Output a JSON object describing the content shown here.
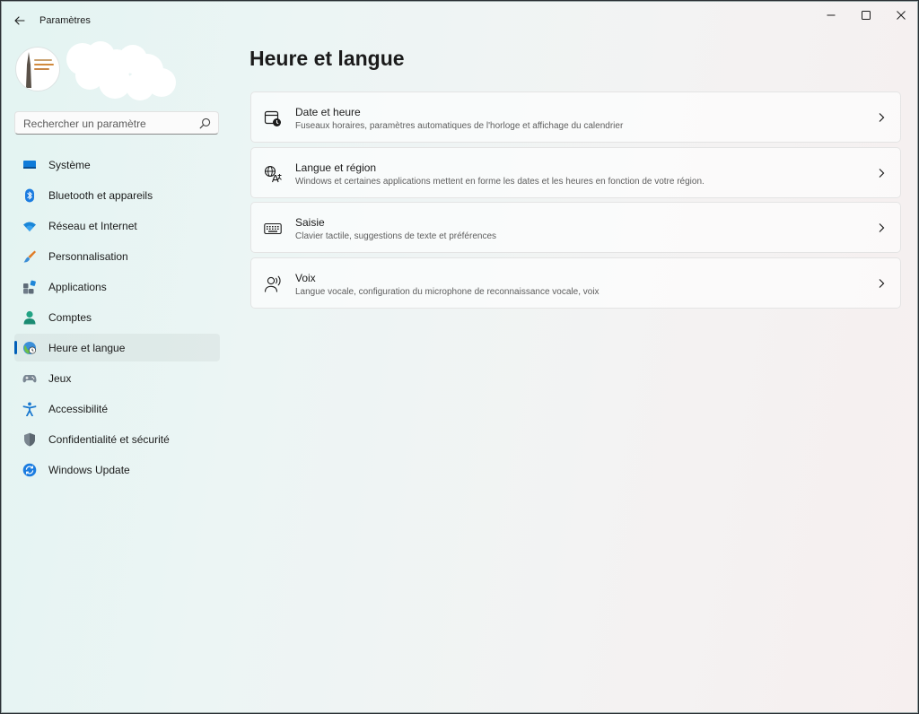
{
  "window": {
    "title": "Paramètres"
  },
  "search": {
    "placeholder": "Rechercher un paramètre"
  },
  "sidebar": {
    "items": [
      {
        "label": "Système",
        "icon": "system-icon"
      },
      {
        "label": "Bluetooth et appareils",
        "icon": "bluetooth-icon"
      },
      {
        "label": "Réseau et Internet",
        "icon": "wifi-icon"
      },
      {
        "label": "Personnalisation",
        "icon": "brush-icon"
      },
      {
        "label": "Applications",
        "icon": "apps-icon"
      },
      {
        "label": "Comptes",
        "icon": "account-icon"
      },
      {
        "label": "Heure et langue",
        "icon": "time-language-icon",
        "selected": true
      },
      {
        "label": "Jeux",
        "icon": "gamepad-icon"
      },
      {
        "label": "Accessibilité",
        "icon": "accessibility-icon"
      },
      {
        "label": "Confidentialité et sécurité",
        "icon": "shield-icon"
      },
      {
        "label": "Windows Update",
        "icon": "update-icon"
      }
    ]
  },
  "main": {
    "title": "Heure et langue",
    "cards": [
      {
        "title": "Date et heure",
        "description": "Fuseaux horaires, paramètres automatiques de l'horloge et affichage du calendrier",
        "icon": "calendar-clock-icon"
      },
      {
        "title": "Langue et région",
        "description": "Windows et certaines applications mettent en forme les dates et les heures en fonction de votre région.",
        "icon": "language-icon"
      },
      {
        "title": "Saisie",
        "description": "Clavier tactile, suggestions de texte et préférences",
        "icon": "keyboard-icon"
      },
      {
        "title": "Voix",
        "description": "Langue vocale, configuration du microphone de reconnaissance vocale, voix",
        "icon": "voice-icon"
      }
    ]
  },
  "colors": {
    "accent": "#005fb8",
    "window_background": "#e8f4f2"
  }
}
